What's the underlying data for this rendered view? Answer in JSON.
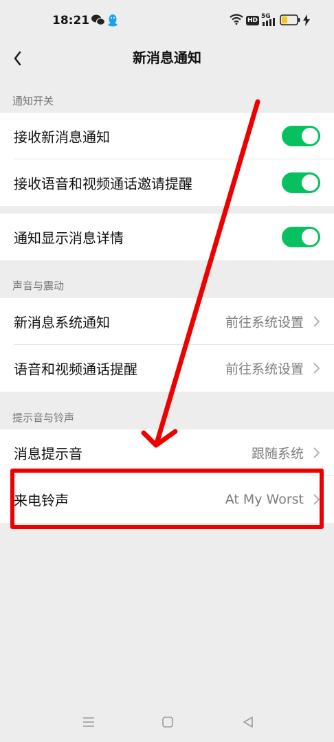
{
  "status_bar": {
    "time": "18:21",
    "hd_badge": "HD",
    "network": "5G",
    "colors": {
      "battery_level": "#f5c518"
    }
  },
  "header": {
    "title": "新消息通知",
    "back_icon": "chevron-left-icon"
  },
  "sections": {
    "notifications": {
      "label": "通知开关",
      "items": [
        {
          "label": "接收新消息通知",
          "toggle": true
        },
        {
          "label": "接收语音和视频通话邀请提醒",
          "toggle": true
        }
      ]
    },
    "details": {
      "items": [
        {
          "label": "通知显示消息详情",
          "toggle": true
        }
      ]
    },
    "sound_vibration": {
      "label": "声音与震动",
      "items": [
        {
          "label": "新消息系统通知",
          "value": "前往系统设置"
        },
        {
          "label": "语音和视频通话提醒",
          "value": "前往系统设置"
        }
      ]
    },
    "tones": {
      "label": "提示音与铃声",
      "items": [
        {
          "label": "消息提示音",
          "value": "跟随系统"
        },
        {
          "label": "来电铃声",
          "value": "At My Worst"
        }
      ]
    }
  },
  "annotation": {
    "color": "#ee0000",
    "arrow_icon": "arrow-annotation",
    "box_icon": "highlight-box"
  },
  "colors": {
    "toggle_on": "#07c160",
    "background": "#ededed"
  },
  "nav_keys": [
    "menu-icon",
    "home-icon",
    "back-icon"
  ]
}
